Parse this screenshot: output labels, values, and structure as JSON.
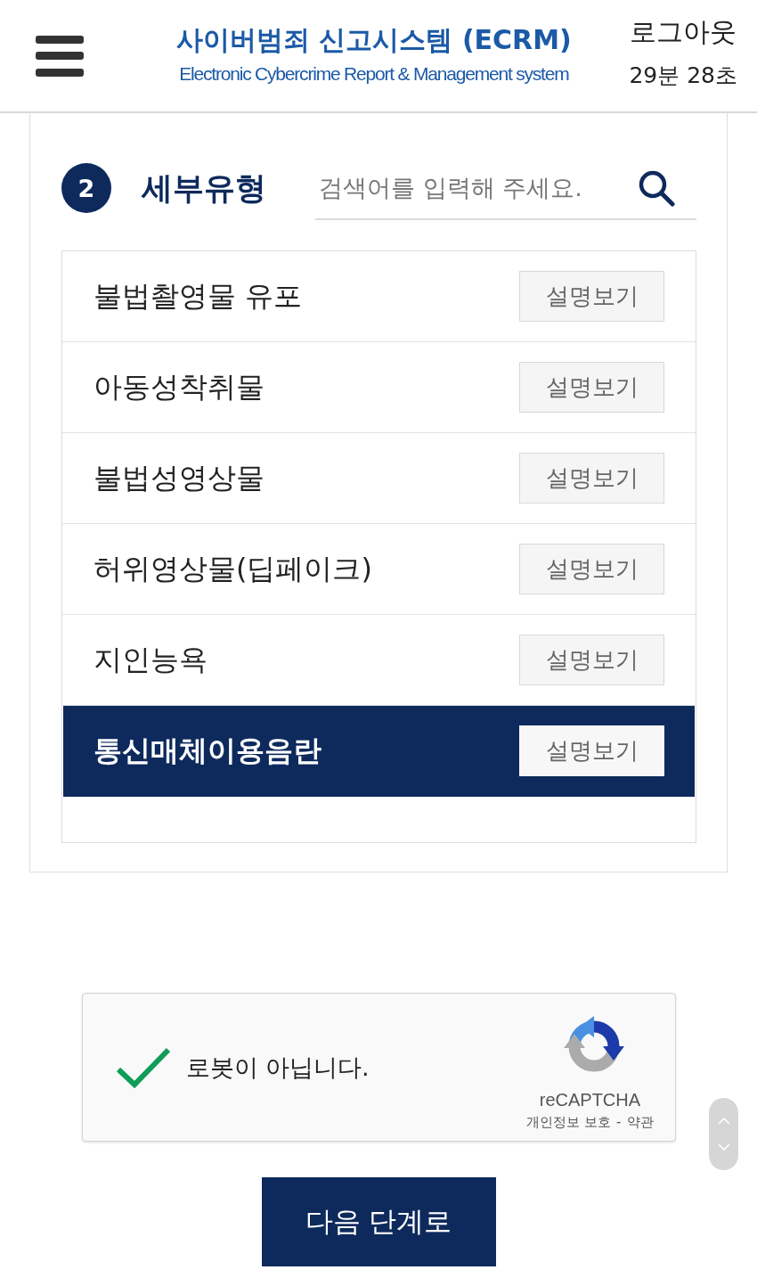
{
  "header": {
    "title": "사이버범죄 신고시스템 (ECRM)",
    "subtitle": "Electronic Cybercrime Report & Management system",
    "logout": "로그아웃",
    "timer": "29분 28초"
  },
  "section": {
    "step": "2",
    "title": "세부유형",
    "search": {
      "placeholder": "검색어를 입력해 주세요."
    }
  },
  "items": [
    {
      "label": "불법촬영물 유포",
      "button": "설명보기",
      "selected": false
    },
    {
      "label": "아동성착취물",
      "button": "설명보기",
      "selected": false
    },
    {
      "label": "불법성영상물",
      "button": "설명보기",
      "selected": false
    },
    {
      "label": "허위영상물(딥페이크)",
      "button": "설명보기",
      "selected": false
    },
    {
      "label": "지인능욕",
      "button": "설명보기",
      "selected": false
    },
    {
      "label": "통신매체이용음란",
      "button": "설명보기",
      "selected": true
    }
  ],
  "captcha": {
    "checked": true,
    "label": "로봇이 아닙니다.",
    "brand": "reCAPTCHA",
    "privacy": "개인정보 보호",
    "separator": "-",
    "terms": "약관"
  },
  "next_button": "다음 단계로"
}
